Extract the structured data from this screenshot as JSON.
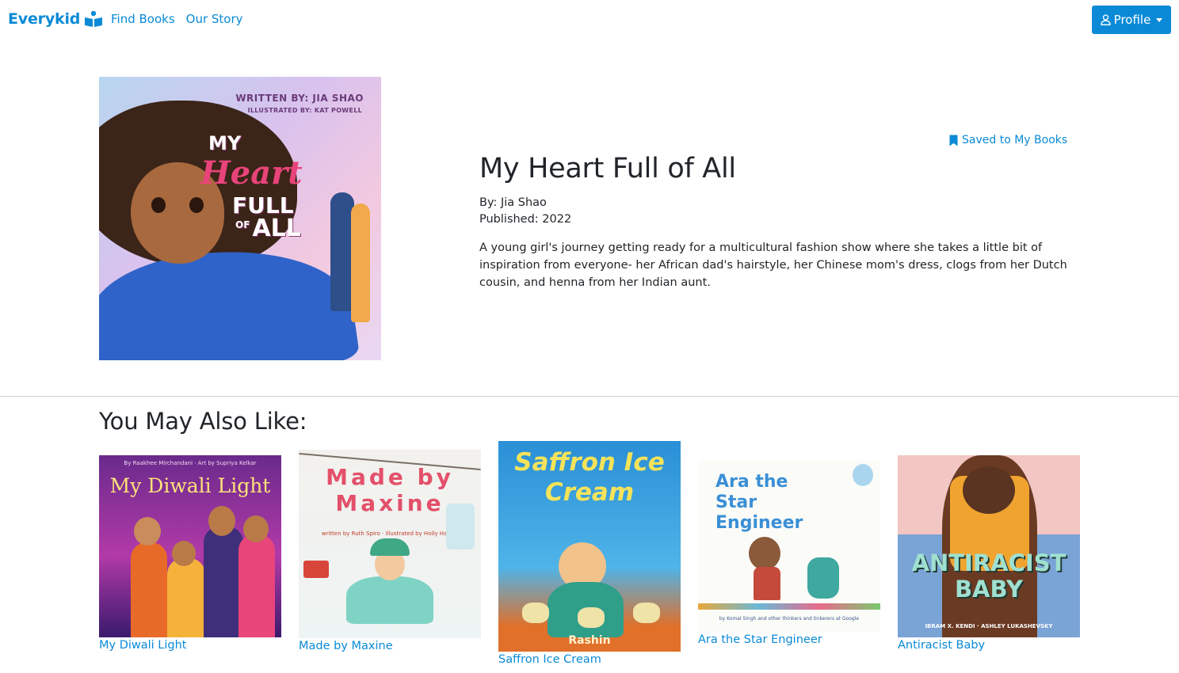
{
  "brand": {
    "name": "Everykid",
    "icon": "reading-child-icon"
  },
  "nav": {
    "links": [
      {
        "label": "Find Books"
      },
      {
        "label": "Our Story"
      }
    ],
    "profile": {
      "label": "Profile",
      "icon": "user-icon"
    }
  },
  "colors": {
    "accent": "#0a8ad6",
    "text": "#212529",
    "divider": "#cfcfcf"
  },
  "book": {
    "title": "My Heart Full of All",
    "author_line": "By: Jia Shao",
    "published_line": "Published: 2022",
    "description": "A young girl's journey getting ready for a multicultural fashion show where she takes a little bit of inspiration from everyone- her African dad's hairstyle, her Chinese mom's dress, clogs from her Dutch cousin, and henna from her Indian aunt.",
    "saved_label": "Saved to My Books",
    "saved_icon": "bookmark-icon",
    "cover": {
      "written_by": "WRITTEN BY: JIA SHAO",
      "illustrated_by": "ILLUSTRATED BY: KAT POWELL",
      "title_my": "MY",
      "title_heart": "Heart",
      "title_full": "FULL",
      "title_of": "OF",
      "title_all": "ALL"
    }
  },
  "recommendations": {
    "heading": "You May Also Like:",
    "items": [
      {
        "title": "My Diwali Light",
        "cover_title": "My Diwali Light",
        "cover_credits": "By Raakhee Mirchandani · Art by Supriya Kelkar"
      },
      {
        "title": "Made by Maxine",
        "cover_title": "Made by Maxine",
        "cover_credits": "written by Ruth Spiro · illustrated by Holly Hatam"
      },
      {
        "title": "Saffron Ice Cream",
        "cover_title": "Saffron Ice Cream",
        "cover_credits": "Rashin"
      },
      {
        "title": "Ara the Star Engineer",
        "cover_title": "Ara the Star Engineer",
        "cover_credits": "by Komal Singh and other thinkers and tinkerers at Google"
      },
      {
        "title": "Antiracist Baby",
        "cover_title": "ANTIRACIST BABY",
        "cover_credits": "IBRAM X. KENDI · ASHLEY LUKASHEVSKY"
      }
    ]
  }
}
